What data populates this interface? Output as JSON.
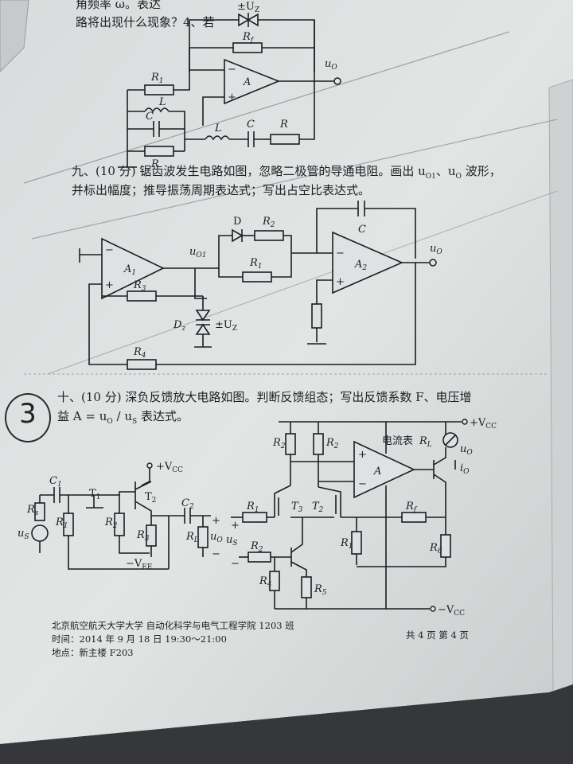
{
  "page": {
    "top_fragment_1": "角频率 ω。表达",
    "top_fragment_2": "路将出现什么现象？4、若",
    "q9_line1": "九、(10 分) 锯齿波发生电路如图，忽略二极管的导通电阻。画出 u",
    "q9_line1_sub1": "O1",
    "q9_line1_mid": "、u",
    "q9_line1_sub2": "O",
    "q9_line1_end": " 波形，",
    "q9_line2": "并标出幅度；推导振荡周期表达式；写出占空比表达式。",
    "q10_line1": "十、(10 分) 深负反馈放大电路如图。判断反馈组态；写出反馈系数 F、电压增",
    "q10_line2": "益 A = u",
    "q10_line2_sub1": "O",
    "q10_line2_mid": " / u",
    "q10_line2_sub2": "S",
    "q10_line2_end": " 表达式。",
    "footer_school": "北京航空航天大学大学   自动化科学与电气工程学院   1203 班",
    "footer_time": "时间：2014 年 9 月 18 日 19:30～21:00",
    "footer_place": "地点：新主楼 F203",
    "footer_pages": "共 4 页  第 4 页",
    "margin_mark": "3"
  },
  "circuit_top": {
    "zener": "±U",
    "zener_sub": "Z",
    "rf": "R",
    "rf_sub": "f",
    "amp": "A",
    "out": "u",
    "out_sub": "O",
    "r1": "R",
    "r1_sub": "1",
    "l1": "L",
    "c1": "C",
    "r_bottom": "R",
    "l2": "L",
    "c2": "C",
    "r2": "R"
  },
  "circuit_saw": {
    "a1": "A",
    "a1_sub": "1",
    "uo1": "u",
    "uo1_sub": "O1",
    "d": "D",
    "r2": "R",
    "r2_sub": "2",
    "r1": "R",
    "r1_sub": "1",
    "c": "C",
    "a2": "A",
    "a2_sub": "2",
    "uo": "u",
    "uo_sub": "O",
    "r3": "R",
    "r3_sub": "3",
    "dz": "D",
    "dz_sub": "z",
    "uz": "±U",
    "uz_sub": "Z",
    "r4": "R",
    "r4_sub": "4"
  },
  "circuit_left": {
    "vcc": "+V",
    "vcc_sub": "CC",
    "c1": "C",
    "c1_sub": "1",
    "t1": "T",
    "t1_sub": "1",
    "t2": "T",
    "t2_sub": "2",
    "rs": "R",
    "rs_sub": "s",
    "us": "u",
    "us_sub": "S",
    "r1": "R",
    "r1_sub": "1",
    "r2": "R",
    "r2_sub": "2",
    "r3": "R",
    "r3_sub": "3",
    "c2": "C",
    "c2_sub": "2",
    "rl": "R",
    "rl_sub": "L",
    "uo": "u",
    "uo_sub": "O",
    "vee": "−V",
    "vee_sub": "EE",
    "plus": "+",
    "minus": "−"
  },
  "circuit_right": {
    "vcc": "+V",
    "vcc_sub": "CC",
    "r2a": "R",
    "r2a_sub": "2",
    "r2b": "R",
    "r2b_sub": "2",
    "amp": "A",
    "meter": "电流表",
    "rl": "R",
    "rl_sub": "L",
    "uo": "u",
    "uo_sub": "O",
    "io": "i",
    "io_sub": "O",
    "r1": "R",
    "r1_sub": "1",
    "t3": "T",
    "t3_sub": "3",
    "t2": "T",
    "t2_sub": "2",
    "rf": "R",
    "rf_sub": "f",
    "us": "u",
    "us_sub": "S",
    "r2c": "R",
    "r2c_sub": "2",
    "r1b": "R",
    "r1b_sub": "1",
    "r6": "R",
    "r6_sub": "6",
    "r4": "R",
    "r4_sub": "4",
    "r5": "R",
    "r5_sub": "5",
    "vcc_neg": "−V",
    "vcc_neg_sub": "CC",
    "plus": "+",
    "minus": "−"
  }
}
